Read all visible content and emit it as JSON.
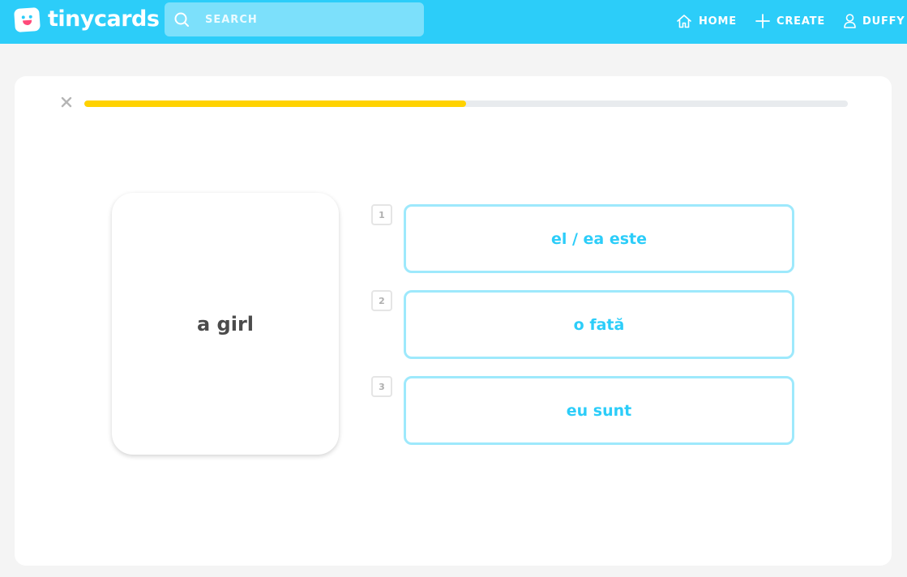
{
  "app": {
    "logo_text": "tinycards"
  },
  "search": {
    "placeholder": "SEARCH"
  },
  "nav": {
    "home": "HOME",
    "create": "CREATE",
    "user": "DUFFY"
  },
  "colors": {
    "brand": "#2ccdf9",
    "progress": "#ffd200",
    "option_border": "#9ee9fc"
  },
  "quiz": {
    "progress_fraction": 0.5,
    "prompt": "a girl",
    "options": [
      {
        "key": "1",
        "label": "el / ea este"
      },
      {
        "key": "2",
        "label": "o fată"
      },
      {
        "key": "3",
        "label": "eu sunt"
      }
    ]
  }
}
